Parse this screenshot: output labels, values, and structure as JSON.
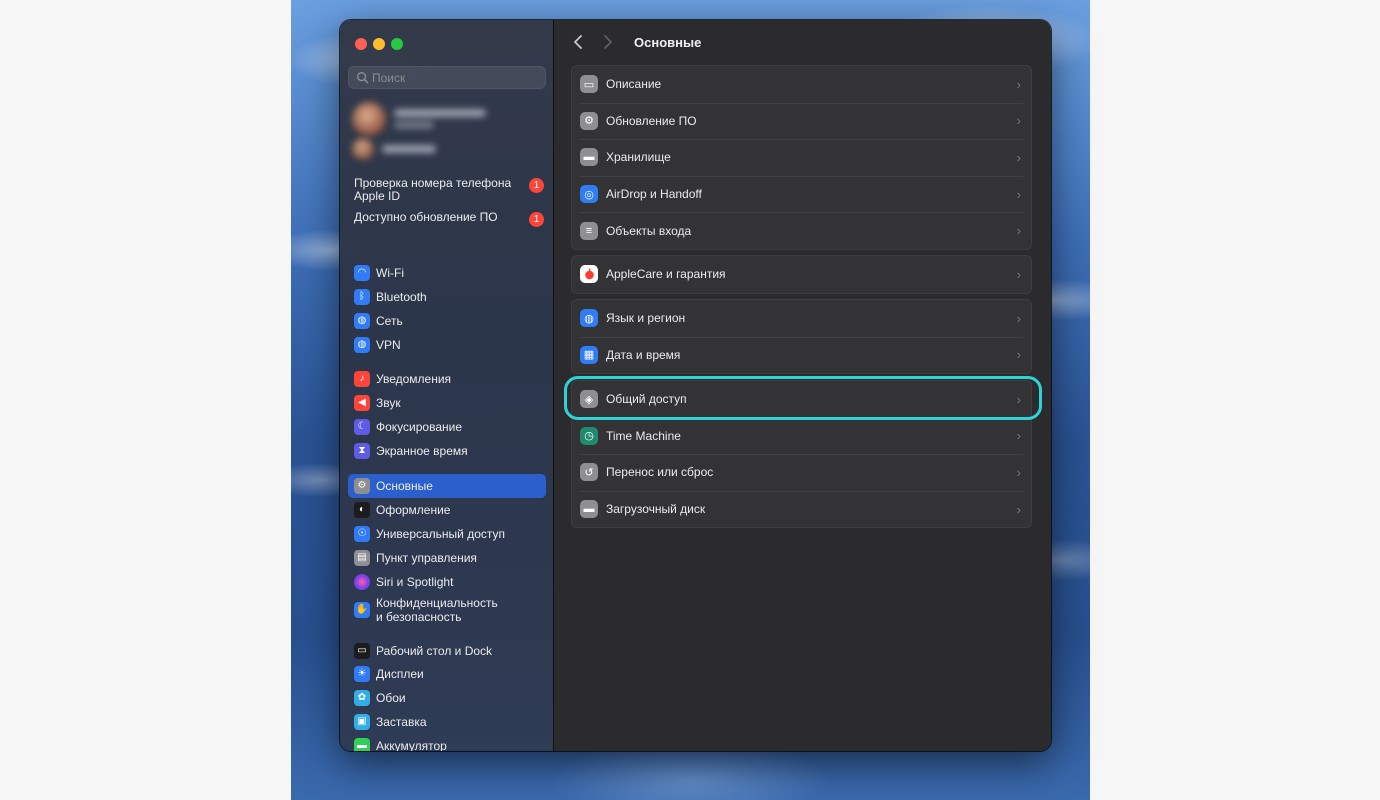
{
  "search": {
    "placeholder": "Поиск"
  },
  "notices": [
    {
      "text": "Проверка номера телефона Apple ID",
      "badge": "1"
    },
    {
      "text": "Доступно обновление ПО",
      "badge": "1"
    }
  ],
  "sidebar": {
    "items": [
      {
        "label": "Wi-Fi",
        "icon": "wifi-icon",
        "color": "#2f7cf6"
      },
      {
        "label": "Bluetooth",
        "icon": "bluetooth-icon",
        "color": "#2f7cf6"
      },
      {
        "label": "Сеть",
        "icon": "globe-icon",
        "color": "#2f7cf6"
      },
      {
        "label": "VPN",
        "icon": "globe-icon",
        "color": "#2f7cf6"
      },
      {
        "label": "Уведомления",
        "icon": "bell-icon",
        "color": "#ff453a"
      },
      {
        "label": "Звук",
        "icon": "speaker-icon",
        "color": "#ff453a"
      },
      {
        "label": "Фокусирование",
        "icon": "moon-icon",
        "color": "#5e5ce6"
      },
      {
        "label": "Экранное время",
        "icon": "hourglass-icon",
        "color": "#5e5ce6"
      },
      {
        "label": "Основные",
        "icon": "gear-icon",
        "color": "#8e8e93",
        "selected": true
      },
      {
        "label": "Оформление",
        "icon": "appearance-icon",
        "color": "#1c1c1e"
      },
      {
        "label": "Универсальный доступ",
        "icon": "accessibility-icon",
        "color": "#2f7cf6"
      },
      {
        "label": "Пункт управления",
        "icon": "control-center-icon",
        "color": "#8e8e93"
      },
      {
        "label": "Siri и Spotlight",
        "icon": "siri-icon",
        "color": "#b04adf"
      },
      {
        "label": "Конфиденциальность и безопасность",
        "icon": "hand-icon",
        "color": "#2f7cf6"
      },
      {
        "label": "Рабочий стол и Dock",
        "icon": "dock-icon",
        "color": "#1c1c1e"
      },
      {
        "label": "Дисплеи",
        "icon": "sun-icon",
        "color": "#2f7cf6"
      },
      {
        "label": "Обои",
        "icon": "flower-icon",
        "color": "#32ade6"
      },
      {
        "label": "Заставка",
        "icon": "screensaver-icon",
        "color": "#32ade6"
      },
      {
        "label": "Аккумулятор",
        "icon": "battery-icon",
        "color": "#30d158"
      }
    ]
  },
  "main": {
    "title": "Основные",
    "groups": [
      [
        {
          "label": "Описание",
          "icon": "laptop-icon",
          "color": "#8e8e93"
        },
        {
          "label": "Обновление ПО",
          "icon": "gear-badge-icon",
          "color": "#8e8e93"
        },
        {
          "label": "Хранилище",
          "icon": "drive-icon",
          "color": "#8e8e93"
        },
        {
          "label": "AirDrop и Handoff",
          "icon": "airdrop-icon",
          "color": "#2f7cf6"
        },
        {
          "label": "Объекты входа",
          "icon": "list-icon",
          "color": "#8e8e93"
        }
      ],
      [
        {
          "label": "AppleCare и гарантия",
          "icon": "apple-icon",
          "color": "#ffffff"
        }
      ],
      [
        {
          "label": "Язык и регион",
          "icon": "globe-icon",
          "color": "#2f7cf6"
        },
        {
          "label": "Дата и время",
          "icon": "calendar-icon",
          "color": "#2f7cf6"
        }
      ],
      [
        {
          "label": "Общий доступ",
          "icon": "sharing-icon",
          "color": "#8e8e93"
        },
        {
          "label": "Time Machine",
          "icon": "time-machine-icon",
          "color": "#1f8a6e"
        },
        {
          "label": "Перенос или сброс",
          "icon": "reset-icon",
          "color": "#8e8e93"
        },
        {
          "label": "Загрузочный диск",
          "icon": "drive-icon",
          "color": "#8e8e93"
        }
      ]
    ]
  },
  "colors": {
    "selection": "#2a5fcc",
    "highlight": "#2ed3d6",
    "badge": "#ff453a"
  }
}
